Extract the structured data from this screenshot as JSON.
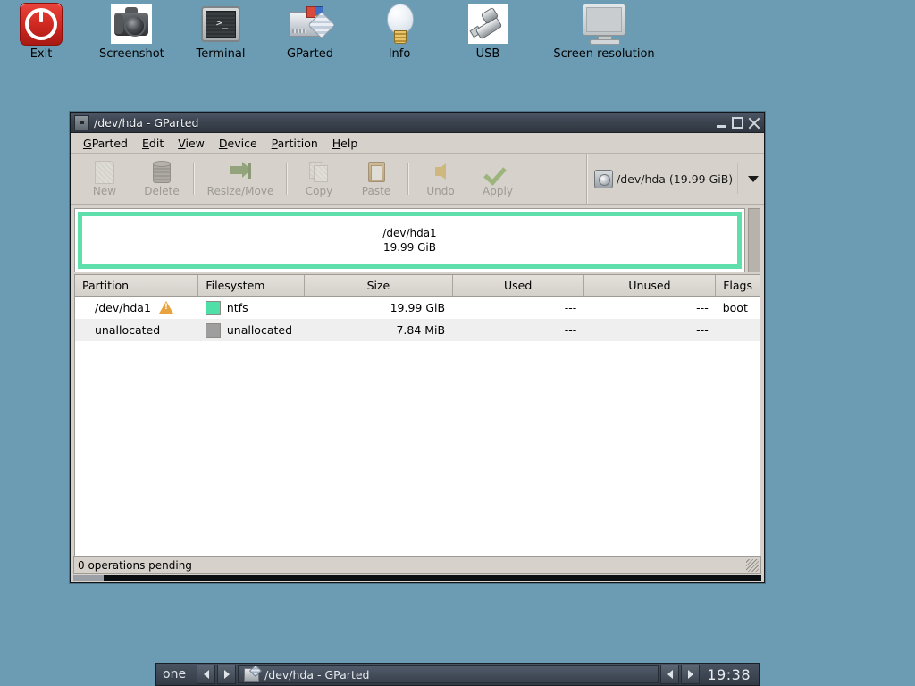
{
  "desktop": {
    "background_color": "#6b9cb4",
    "icons": [
      {
        "label": "Exit",
        "icon": "power-icon"
      },
      {
        "label": "Screenshot",
        "icon": "camera-icon"
      },
      {
        "label": "Terminal",
        "icon": "terminal-icon"
      },
      {
        "label": "GParted",
        "icon": "disk-partition-icon"
      },
      {
        "label": "Info",
        "icon": "lightbulb-icon"
      },
      {
        "label": "USB",
        "icon": "usb-stick-icon"
      },
      {
        "label": "Screen resolution",
        "icon": "monitor-icon"
      }
    ]
  },
  "window": {
    "title": "/dev/hda - GParted",
    "menu_button": "window-menu",
    "controls": {
      "minimize": "minimize",
      "maximize": "maximize",
      "close": "close"
    },
    "menus": [
      {
        "label": "GParted",
        "mnemonic": "G"
      },
      {
        "label": "Edit",
        "mnemonic": "E"
      },
      {
        "label": "View",
        "mnemonic": "V"
      },
      {
        "label": "Device",
        "mnemonic": "D"
      },
      {
        "label": "Partition",
        "mnemonic": "P"
      },
      {
        "label": "Help",
        "mnemonic": "H"
      }
    ],
    "toolbar": {
      "buttons": [
        {
          "label": "New",
          "icon": "new-document-icon",
          "enabled": false
        },
        {
          "label": "Delete",
          "icon": "trash-icon",
          "enabled": false
        },
        {
          "label": "Resize/Move",
          "icon": "resize-arrow-icon",
          "enabled": false
        },
        {
          "label": "Copy",
          "icon": "copy-icon",
          "enabled": false
        },
        {
          "label": "Paste",
          "icon": "clipboard-icon",
          "enabled": false
        },
        {
          "label": "Undo",
          "icon": "undo-arrow-icon",
          "enabled": false
        },
        {
          "label": "Apply",
          "icon": "checkmark-icon",
          "enabled": false
        }
      ],
      "device_selector": {
        "icon": "hard-disk-icon",
        "value": "/dev/hda  (19.99 GiB)",
        "arrow": "chevron-down-icon"
      }
    },
    "graphic": {
      "partition_name": "/dev/hda1",
      "partition_size": "19.99 GiB",
      "border_color": "#5fdfac"
    },
    "table": {
      "columns": [
        "Partition",
        "Filesystem",
        "Size",
        "Used",
        "Unused",
        "Flags"
      ],
      "rows": [
        {
          "partition": "/dev/hda1",
          "warning": true,
          "swatch_color": "#4fe0a8",
          "filesystem": "ntfs",
          "size": "19.99 GiB",
          "used": "---",
          "unused": "---",
          "flags": "boot"
        },
        {
          "partition": "unallocated",
          "warning": false,
          "swatch_color": "#9e9e9e",
          "filesystem": "unallocated",
          "size": "7.84 MiB",
          "used": "---",
          "unused": "---",
          "flags": ""
        }
      ]
    },
    "statusbar": {
      "text": "0 operations pending"
    }
  },
  "taskbar": {
    "workspace": "one",
    "prev_arrow": "left-arrow-icon",
    "next_arrow": "right-arrow-icon",
    "task": {
      "title": "/dev/hda - GParted",
      "icon": "gparted-icon"
    },
    "clock": "19:38"
  }
}
